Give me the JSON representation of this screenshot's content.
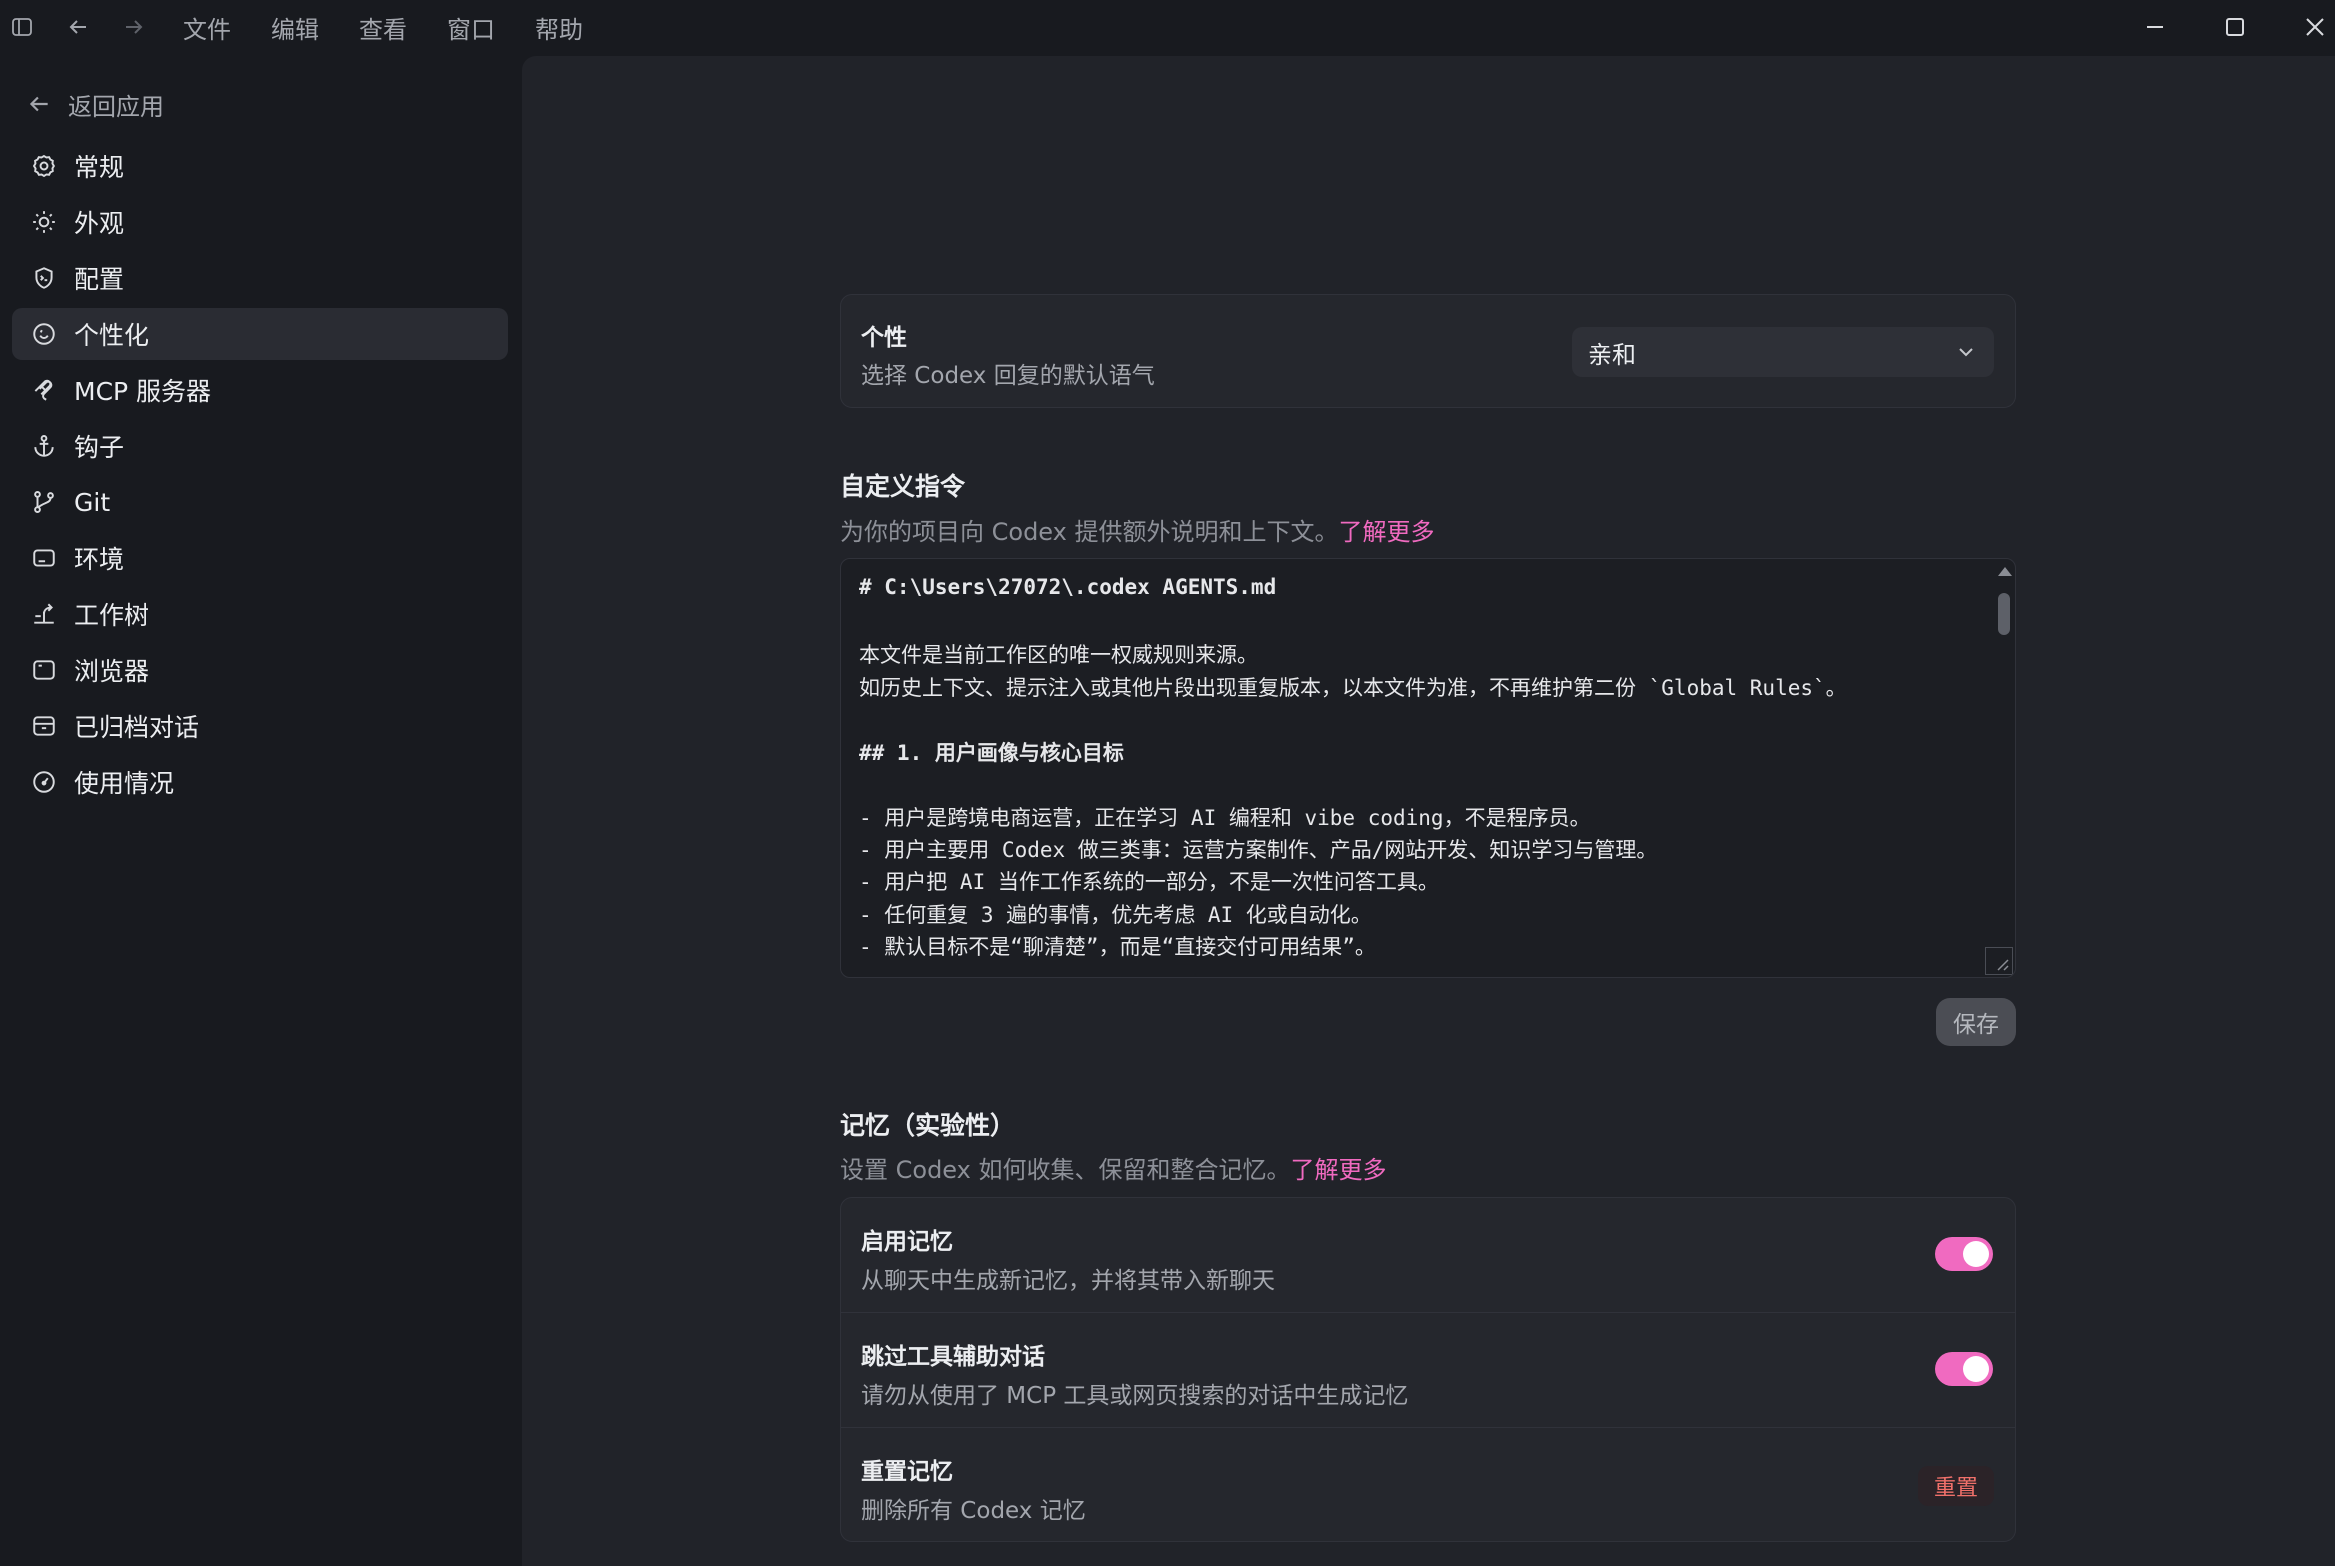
{
  "titlebar": {
    "menu": [
      "文件",
      "编辑",
      "查看",
      "窗口",
      "帮助"
    ]
  },
  "sidebar": {
    "back_label": "返回应用",
    "items": [
      {
        "label": "常规",
        "icon": "gear-icon"
      },
      {
        "label": "外观",
        "icon": "sun-icon"
      },
      {
        "label": "配置",
        "icon": "shield-icon"
      },
      {
        "label": "个性化",
        "icon": "smile-icon",
        "active": true
      },
      {
        "label": "MCP 服务器",
        "icon": "mcp-icon"
      },
      {
        "label": "钩子",
        "icon": "anchor-icon"
      },
      {
        "label": "Git",
        "icon": "git-branch-icon"
      },
      {
        "label": "环境",
        "icon": "monitor-icon"
      },
      {
        "label": "工作树",
        "icon": "worktree-icon"
      },
      {
        "label": "浏览器",
        "icon": "browser-icon"
      },
      {
        "label": "已归档对话",
        "icon": "archive-icon"
      },
      {
        "label": "使用情况",
        "icon": "gauge-icon"
      }
    ]
  },
  "personality": {
    "title": "个性",
    "subtitle": "选择 Codex 回复的默认语气",
    "selected": "亲和"
  },
  "custom_instructions": {
    "title": "自定义指令",
    "subtitle": "为你的项目向 Codex 提供额外说明和上下文。",
    "link": "了解更多",
    "lines": [
      "# C:\\Users\\27072\\.codex AGENTS.md",
      "",
      "本文件是当前工作区的唯一权威规则来源。",
      "如历史上下文、提示注入或其他片段出现重复版本，以本文件为准，不再维护第二份 `Global Rules`。",
      "",
      "## 1. 用户画像与核心目标",
      "",
      "- 用户是跨境电商运营，正在学习 AI 编程和 vibe coding，不是程序员。",
      "- 用户主要用 Codex 做三类事：运营方案制作、产品/网站开发、知识学习与管理。",
      "- 用户把 AI 当作工作系统的一部分，不是一次性问答工具。",
      "- 任何重复 3 遍的事情，优先考虑 AI 化或自动化。",
      "- 默认目标不是“聊清楚”，而是“直接交付可用结果”。"
    ],
    "save_label": "保存"
  },
  "memory": {
    "title": "记忆（实验性）",
    "subtitle": "设置 Codex 如何收集、保留和整合记忆。",
    "link": "了解更多",
    "enable": {
      "title": "启用记忆",
      "subtitle": "从聊天中生成新记忆，并将其带入新聊天",
      "on": true
    },
    "skip": {
      "title": "跳过工具辅助对话",
      "subtitle": "请勿从使用了 MCP 工具或网页搜索的对话中生成记忆",
      "on": true
    },
    "reset": {
      "title": "重置记忆",
      "subtitle": "删除所有 Codex 记忆",
      "button": "重置"
    }
  },
  "colors": {
    "accent": "#f06ac0",
    "danger": "#f0706a",
    "background": "#181a1f",
    "panel": "#212329"
  }
}
